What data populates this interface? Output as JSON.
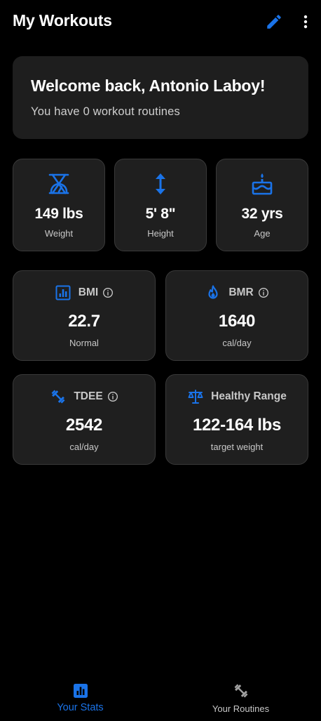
{
  "header": {
    "title": "My Workouts",
    "edit_icon": "pencil-icon",
    "more_icon": "more-vertical-icon"
  },
  "welcome": {
    "title": "Welcome back, Antonio Laboy!",
    "subtitle": "You have 0 workout routines"
  },
  "basic_stats": [
    {
      "icon": "scale-icon",
      "value": "149 lbs",
      "label": "Weight"
    },
    {
      "icon": "height-arrows-icon",
      "value": "5' 8\"",
      "label": "Height"
    },
    {
      "icon": "cake-icon",
      "value": "32 yrs",
      "label": "Age"
    }
  ],
  "metrics": [
    {
      "icon": "chart-icon",
      "label": "BMI",
      "has_info": true,
      "value": "22.7",
      "unit": "Normal"
    },
    {
      "icon": "flame-icon",
      "label": "BMR",
      "has_info": true,
      "value": "1640",
      "unit": "cal/day"
    },
    {
      "icon": "dumbbell-icon",
      "label": "TDEE",
      "has_info": true,
      "value": "2542",
      "unit": "cal/day"
    },
    {
      "icon": "balance-scale-icon",
      "label": "Healthy Range",
      "has_info": false,
      "value": "122-164 lbs",
      "unit": "target weight"
    }
  ],
  "bottom_nav": [
    {
      "icon": "bar-chart-icon",
      "label": "Your Stats",
      "active": true
    },
    {
      "icon": "dumbbell-icon",
      "label": "Your Routines",
      "active": false
    }
  ],
  "colors": {
    "accent": "#1a73e8",
    "background": "#000000",
    "card": "#1f1f1f",
    "card_border": "#3a3a3a",
    "muted_text": "#c8c8c8",
    "inactive_nav": "#a0a0a0"
  }
}
